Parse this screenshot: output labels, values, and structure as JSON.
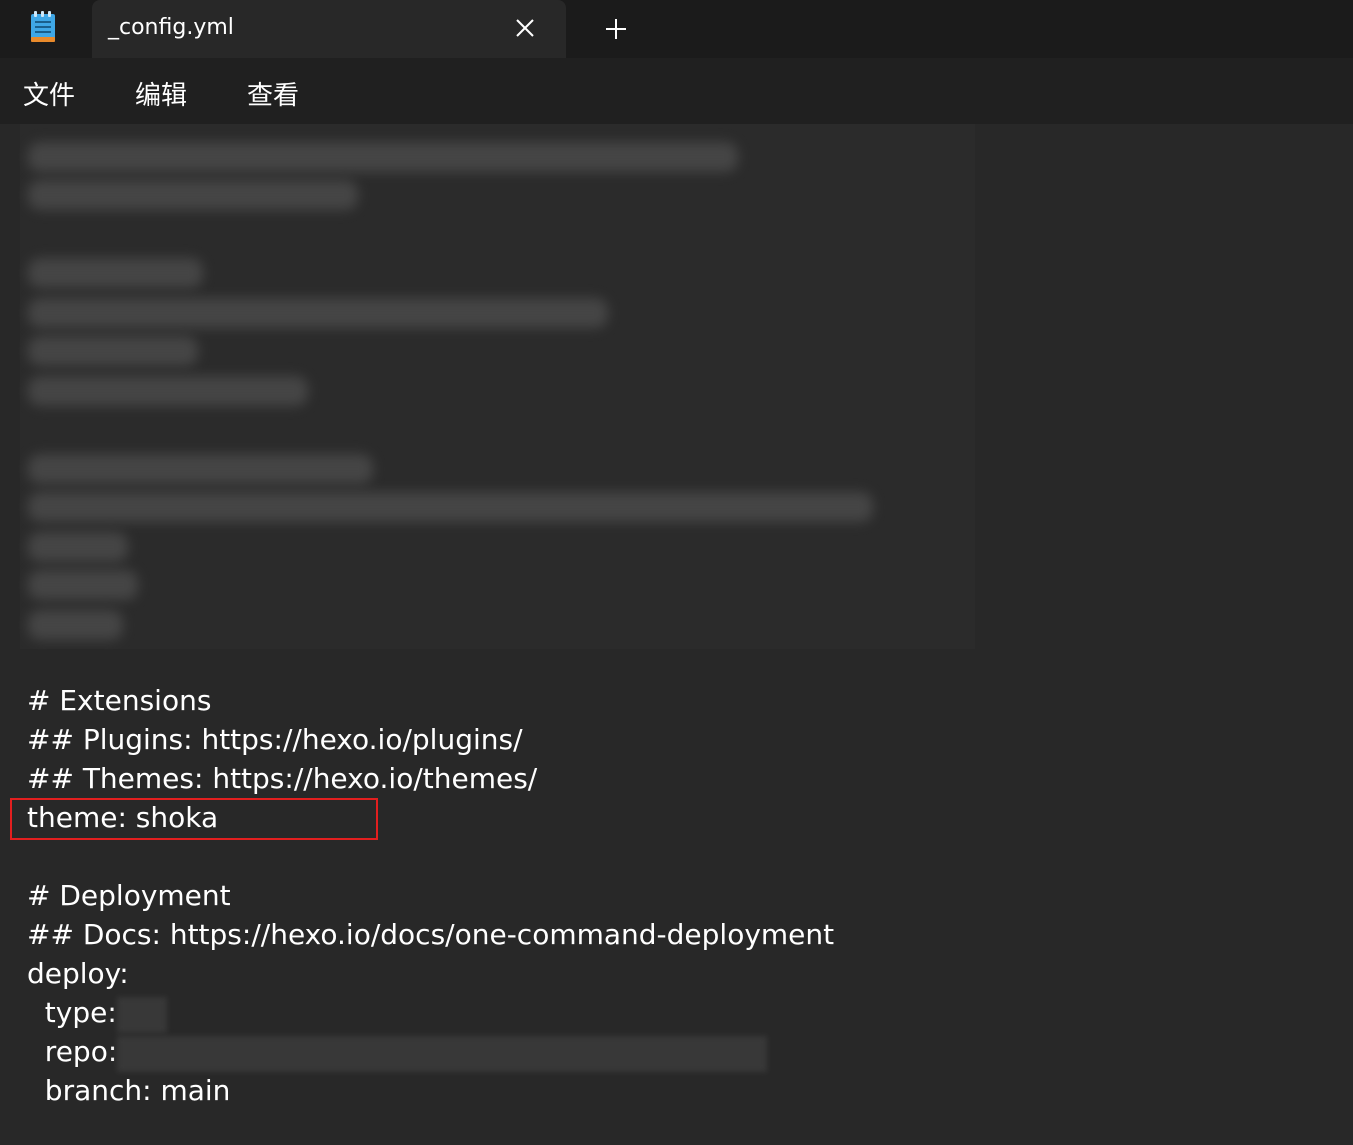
{
  "window": {
    "tab_title": "_config.yml",
    "app_icon": "notepad-icon",
    "close_icon": "close-icon",
    "new_tab_icon": "plus-icon"
  },
  "menu": {
    "items": [
      {
        "label": "文件"
      },
      {
        "label": "编辑"
      },
      {
        "label": "查看"
      }
    ]
  },
  "editor": {
    "lines": [
      "# Extensions",
      "## Plugins: https://hexo.io/plugins/",
      "## Themes: https://hexo.io/themes/",
      "theme: shoka",
      "",
      "# Deployment",
      "## Docs: https://hexo.io/docs/one-command-deployment",
      "deploy:",
      "  type: ",
      "  repo: ",
      "  branch: main"
    ],
    "highlight_color": "#e21f1f"
  }
}
